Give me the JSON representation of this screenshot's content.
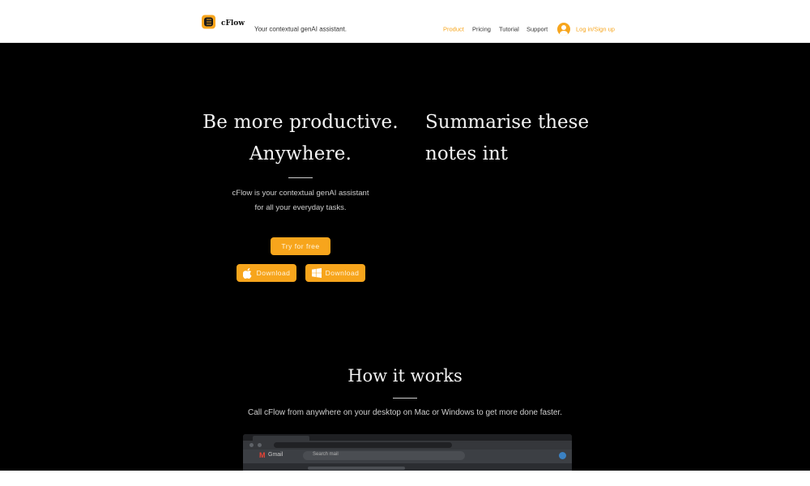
{
  "header": {
    "brand": "cFlow",
    "tagline": "Your contextual genAI assistant.",
    "nav": [
      {
        "label": "Product",
        "active": true
      },
      {
        "label": "Pricing",
        "active": false
      },
      {
        "label": "Tutorial",
        "active": false
      },
      {
        "label": "Support",
        "active": false
      }
    ],
    "login_label": "Log in/Sign up",
    "logo_icon": "cflow-logo-icon",
    "avatar_icon": "user-avatar-icon"
  },
  "hero": {
    "headline_line1": "Be more productive.",
    "headline_line2": "Anywhere.",
    "typing_line1": "Summarise these",
    "typing_line2": "notes int",
    "description_line1": "cFlow is your contextual genAI assistant",
    "description_line2": "for all your everyday tasks.",
    "try_button": "Try for free",
    "download_mac_button": "Download",
    "download_windows_button": "Download",
    "mac_icon": "apple-icon",
    "windows_icon": "windows-icon"
  },
  "how_it_works": {
    "title": "How it works",
    "subtitle": "Call cFlow from anywhere on your desktop on Mac or Windows to get more done faster."
  },
  "preview": {
    "app_label": "Gmail",
    "search_placeholder": "Search mail"
  },
  "colors": {
    "accent": "#f7a51c",
    "background_dark": "#000000",
    "header_bg": "#ffffff"
  }
}
